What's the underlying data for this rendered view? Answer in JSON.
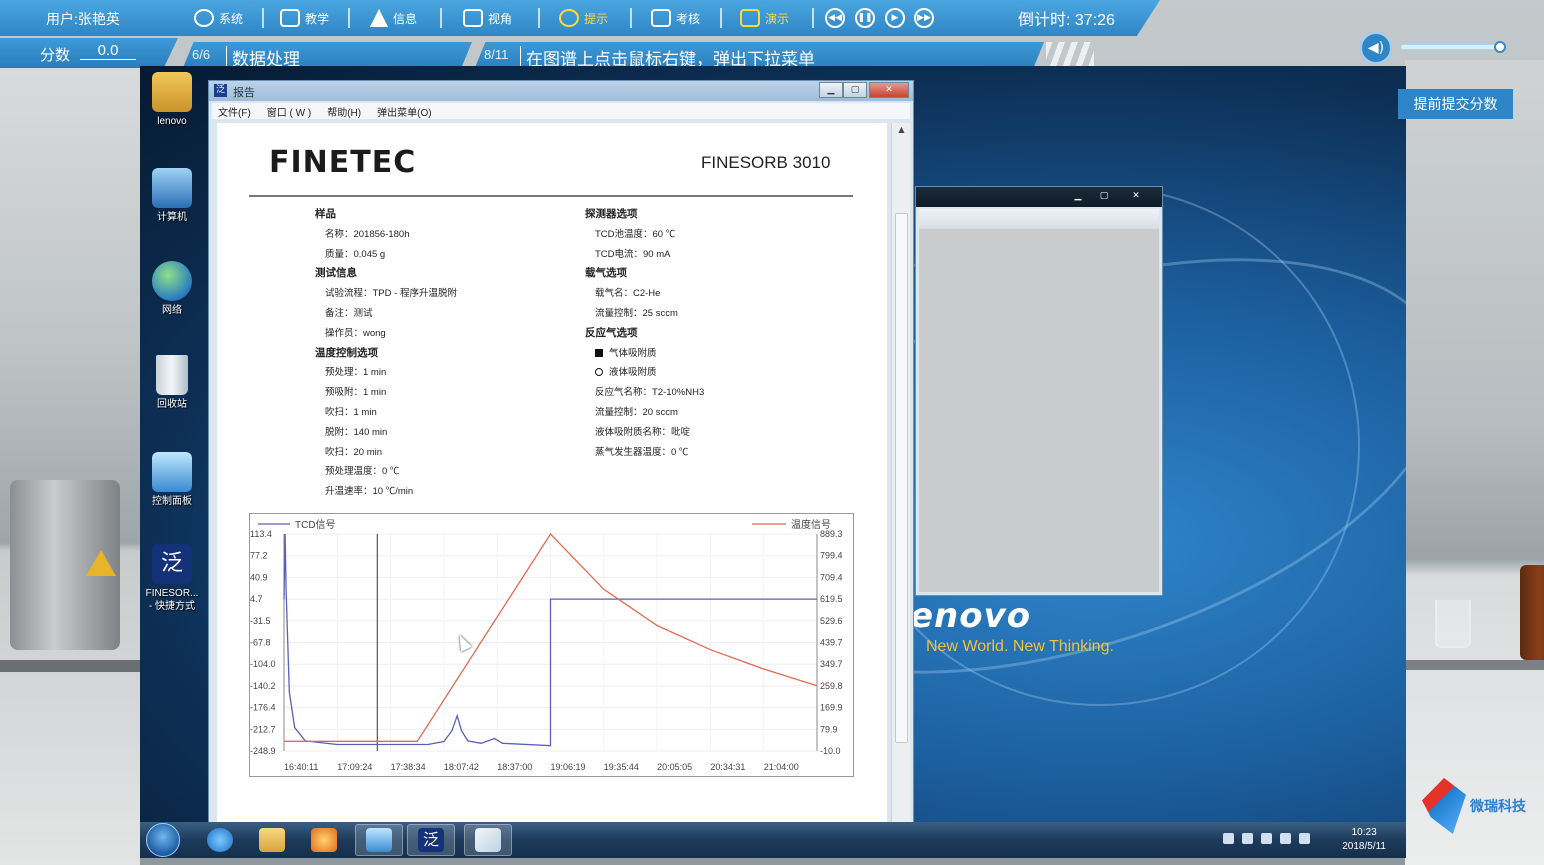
{
  "hud": {
    "user": "用户:张艳英",
    "score_label": "分数",
    "score_value": "0.0",
    "buttons": [
      {
        "label": "系统",
        "icon": "globe-icon"
      },
      {
        "label": "教学",
        "icon": "teach-icon"
      },
      {
        "label": "信息",
        "icon": "warning-icon"
      },
      {
        "label": "视角",
        "icon": "image-icon"
      },
      {
        "label": "提示",
        "icon": "question-icon"
      },
      {
        "label": "考核",
        "icon": "clipboard-icon"
      },
      {
        "label": "演示",
        "icon": "monitor-icon"
      }
    ],
    "countdown": "倒计时: 37:26",
    "volume": 0.95,
    "submit_label": "提前提交分数"
  },
  "steps": {
    "chapter_frac": "6/6",
    "chapter_title": "数据处理",
    "step_frac": "8/11",
    "step_title": "在图谱上点击鼠标右键，弹出下拉菜单"
  },
  "desktop": {
    "icons": [
      {
        "label": "lenovo",
        "icon": "user-folder-icon"
      },
      {
        "label": "计算机",
        "icon": "computer-icon"
      },
      {
        "label": "网络",
        "icon": "network-icon"
      },
      {
        "label": "回收站",
        "icon": "recycle-bin-icon"
      },
      {
        "label": "控制面板",
        "icon": "control-panel-icon"
      },
      {
        "label": "FINESOR...\n- 快捷方式",
        "icon": "finesorb-app-icon"
      }
    ],
    "wallpaper_logo": "enovo",
    "wallpaper_tagline": "New World. New Thinking."
  },
  "report_window": {
    "title": "报告",
    "menu": [
      "文件(F)",
      "窗口 ( W )",
      "帮助(H)",
      "弹出菜单(O)"
    ],
    "logo": "FINETEC",
    "model": "FINESORB 3010",
    "left_column": [
      {
        "type": "head",
        "text": "样品"
      },
      {
        "type": "item",
        "text": "名称：201856-180h"
      },
      {
        "type": "item",
        "text": "质量：0.045 g"
      },
      {
        "type": "head",
        "text": "测试信息"
      },
      {
        "type": "item",
        "text": "试验流程：TPD - 程序升温脱附"
      },
      {
        "type": "item",
        "text": "备注：测试"
      },
      {
        "type": "item",
        "text": "操作员：wong"
      },
      {
        "type": "head",
        "text": "温度控制选项"
      },
      {
        "type": "item",
        "text": "预处理：1 min"
      },
      {
        "type": "item",
        "text": "预吸附：1 min"
      },
      {
        "type": "item",
        "text": "吹扫：1 min"
      },
      {
        "type": "item",
        "text": "脱附：140 min"
      },
      {
        "type": "item",
        "text": "吹扫：20 min"
      },
      {
        "type": "item",
        "text": "预处理温度：0 ℃"
      },
      {
        "type": "item",
        "text": "升温速率：10 ℃/min"
      }
    ],
    "right_column": [
      {
        "type": "head",
        "text": "探测器选项"
      },
      {
        "type": "item",
        "text": "TCD池温度：60 ℃"
      },
      {
        "type": "item",
        "text": "TCD电流：90 mA"
      },
      {
        "type": "head",
        "text": "载气选项"
      },
      {
        "type": "item",
        "text": "载气名：C2-He"
      },
      {
        "type": "item",
        "text": "流量控制：25 sccm"
      },
      {
        "type": "head",
        "text": "反应气选项"
      },
      {
        "type": "item",
        "text": "气体吸附质",
        "marker": "square"
      },
      {
        "type": "item",
        "text": "液体吸附质",
        "marker": "circle"
      },
      {
        "type": "item",
        "text": "反应气名称：T2-10%NH3"
      },
      {
        "type": "item",
        "text": "流量控制：20 sccm"
      },
      {
        "type": "item",
        "text": "液体吸附质名称：吡啶"
      },
      {
        "type": "item",
        "text": "蒸气发生器温度：0 ℃"
      }
    ]
  },
  "chart_data": {
    "type": "line",
    "legend_left": "TCD信号",
    "legend_right": "温度信号",
    "x_ticks": [
      "16:40:11",
      "17:09:24",
      "17:38:34",
      "18:07:42",
      "18:37:00",
      "19:06:19",
      "19:35:44",
      "20:05:05",
      "20:34:31",
      "21:04:00"
    ],
    "y_left_ticks": [
      "113.4",
      "77.2",
      "40.9",
      "4.7",
      "-31.5",
      "-67.8",
      "-104.0",
      "-140.2",
      "-176.4",
      "-212.7",
      "-248.9"
    ],
    "y_right_ticks": [
      "889.3",
      "799.4",
      "709.4",
      "619.5",
      "529.6",
      "439.7",
      "349.7",
      "259.8",
      "169.9",
      "79.9",
      "-10.0"
    ],
    "ylim_left": [
      -248.9,
      113.4
    ],
    "ylim_right": [
      -10.0,
      889.3
    ],
    "marker_x": 0.175,
    "colors": {
      "tcd": "#5a5fb8",
      "temp": "#e06a55"
    },
    "series": [
      {
        "name": "TCD信号",
        "axis": "left",
        "points": [
          [
            0.0,
            4.7
          ],
          [
            0.002,
            113.4
          ],
          [
            0.004,
            20.0
          ],
          [
            0.01,
            -150.0
          ],
          [
            0.02,
            -210.0
          ],
          [
            0.04,
            -232.0
          ],
          [
            0.1,
            -238.0
          ],
          [
            0.2,
            -238.0
          ],
          [
            0.27,
            -238.0
          ],
          [
            0.3,
            -233.0
          ],
          [
            0.315,
            -215.0
          ],
          [
            0.325,
            -190.0
          ],
          [
            0.333,
            -215.0
          ],
          [
            0.345,
            -232.0
          ],
          [
            0.37,
            -236.0
          ],
          [
            0.395,
            -228.0
          ],
          [
            0.41,
            -236.0
          ],
          [
            0.5,
            -240.0
          ],
          [
            0.5,
            4.7
          ],
          [
            1.0,
            4.7
          ]
        ]
      },
      {
        "name": "温度信号",
        "axis": "right",
        "points": [
          [
            0.0,
            30.0
          ],
          [
            0.175,
            30.0
          ],
          [
            0.25,
            30.0
          ],
          [
            0.5,
            889.3
          ],
          [
            0.6,
            660.0
          ],
          [
            0.7,
            510.0
          ],
          [
            0.8,
            410.0
          ],
          [
            0.9,
            330.0
          ],
          [
            1.0,
            260.0
          ]
        ]
      }
    ]
  },
  "taskbar": {
    "items": [
      {
        "icon": "internet-explorer-icon"
      },
      {
        "icon": "explorer-folder-icon"
      },
      {
        "icon": "media-player-icon"
      },
      {
        "icon": "control-panel-icon"
      },
      {
        "icon": "finesorb-app-icon"
      },
      {
        "icon": "paint-icon"
      }
    ],
    "time": "10:23",
    "date": "2018/5/11"
  },
  "brand": {
    "name": "微瑞科技"
  }
}
